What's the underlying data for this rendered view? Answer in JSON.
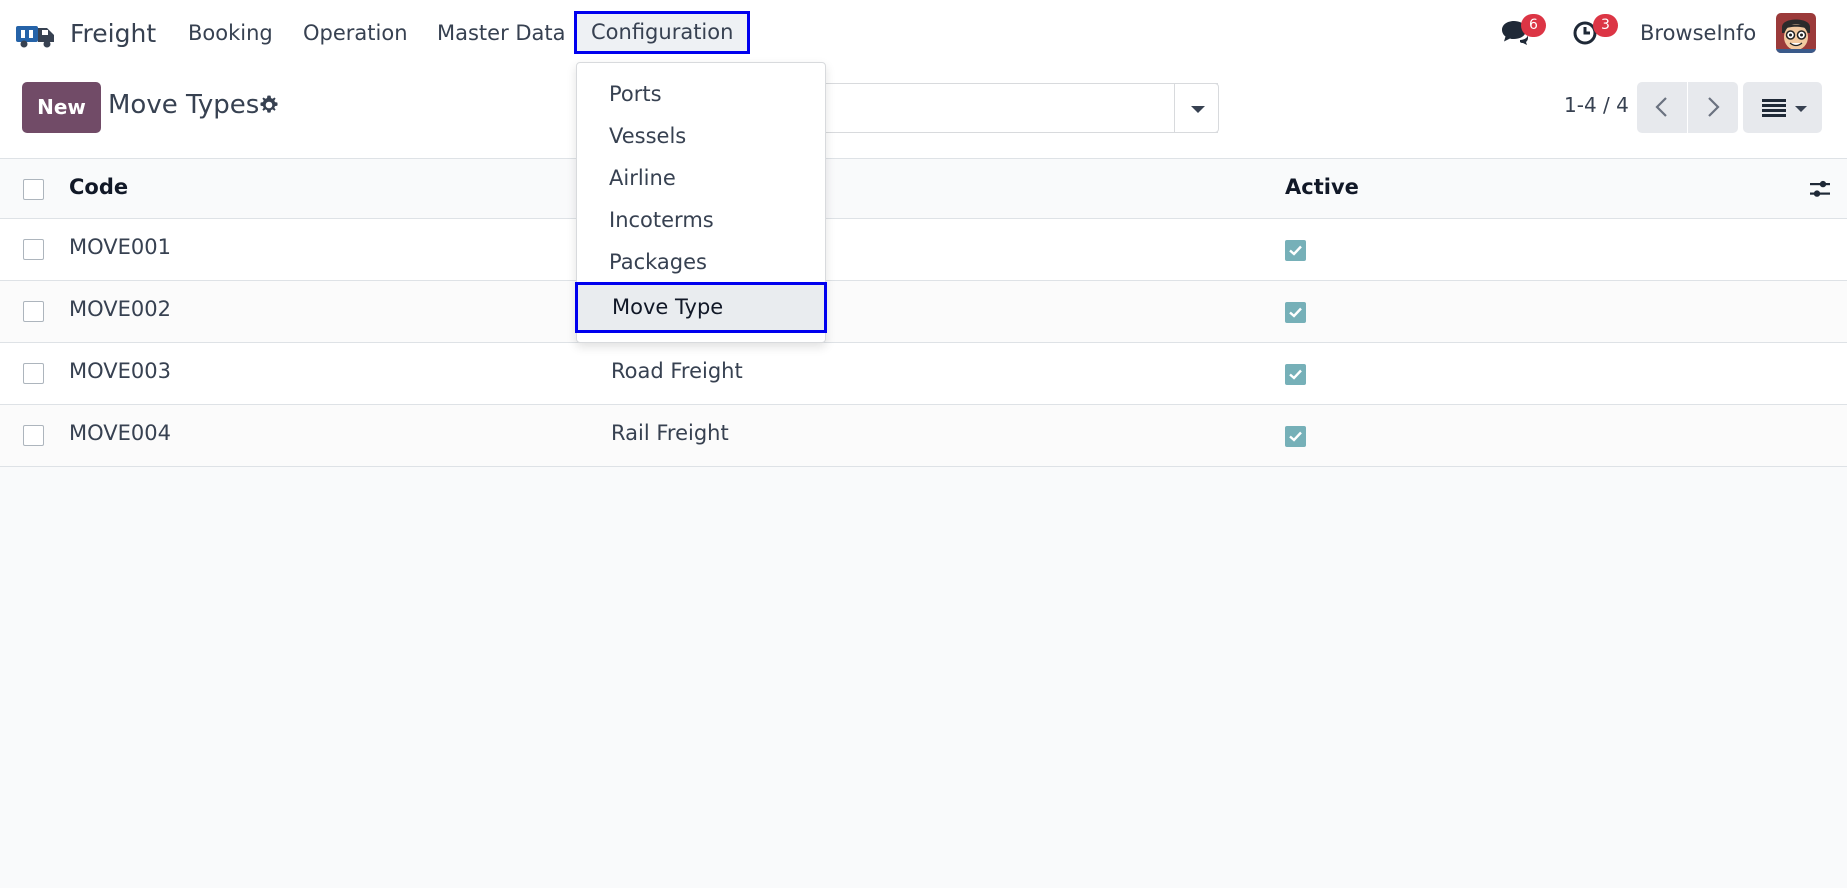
{
  "app": {
    "name": "Freight"
  },
  "navbar": {
    "menus": [
      {
        "label": "Booking"
      },
      {
        "label": "Operation"
      },
      {
        "label": "Master Data"
      },
      {
        "label": "Configuration"
      }
    ],
    "messages_count": "6",
    "activities_count": "3",
    "company": "BrowseInfo"
  },
  "control_panel": {
    "new_label": "New",
    "title": "Move Types",
    "pager": "1-4 / 4"
  },
  "list": {
    "headers": {
      "code": "Code",
      "active": "Active"
    },
    "rows": [
      {
        "code": "MOVE001",
        "name": "",
        "active": true
      },
      {
        "code": "MOVE002",
        "name": "",
        "active": true
      },
      {
        "code": "MOVE003",
        "name": "Road Freight",
        "active": true
      },
      {
        "code": "MOVE004",
        "name": "Rail Freight",
        "active": true
      }
    ]
  },
  "dropdown": {
    "items": [
      {
        "label": "Ports"
      },
      {
        "label": "Vessels"
      },
      {
        "label": "Airline"
      },
      {
        "label": "Incoterms"
      },
      {
        "label": "Packages"
      },
      {
        "label": "Move Type"
      }
    ],
    "selected": "Move Type"
  },
  "colors": {
    "primary": "#714b67",
    "highlight_border": "#0000ee",
    "badge": "#dc3545",
    "checkbox_active": "#76b0b8"
  }
}
